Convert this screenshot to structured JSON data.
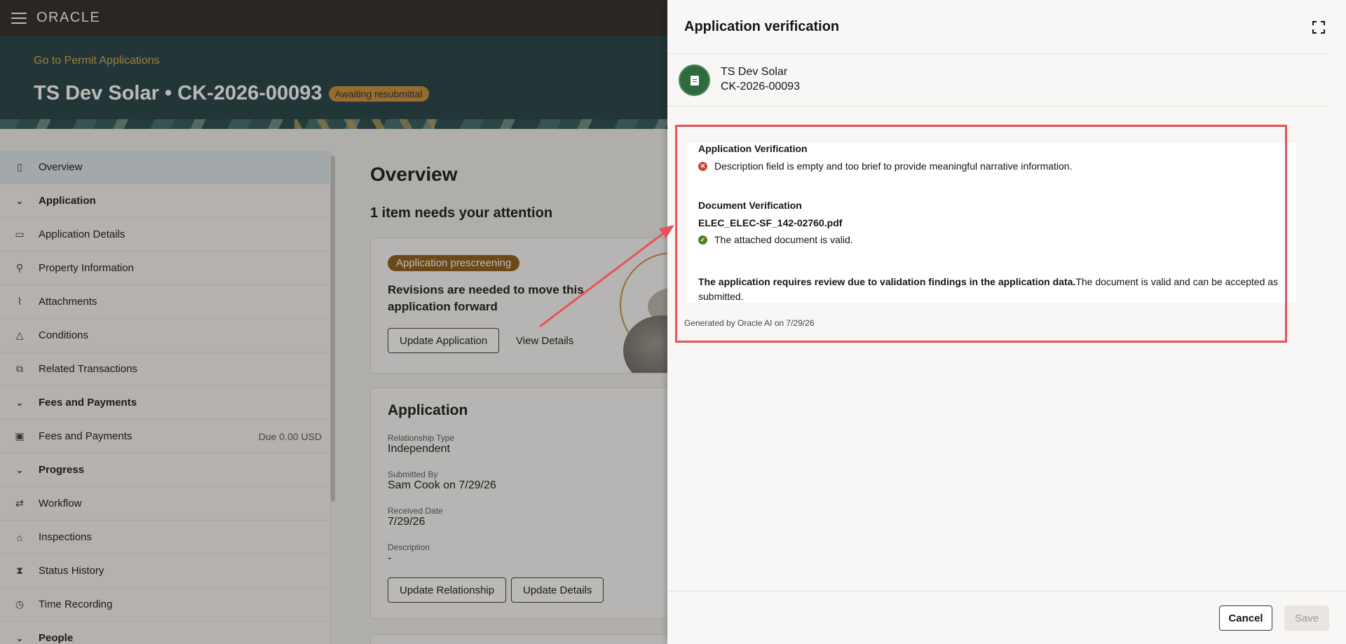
{
  "topbar": {
    "logo": "ORACLE"
  },
  "header": {
    "back_link": "Go to Permit Applications",
    "title": "TS Dev Solar • CK-2026-00093",
    "status": "Awaiting resubmittal"
  },
  "sidebar": {
    "items": [
      {
        "label": "Overview",
        "icon": "overview-icon",
        "type": "item",
        "active": true
      },
      {
        "label": "Application",
        "icon": "chevron-down-icon",
        "type": "section"
      },
      {
        "label": "Application Details",
        "icon": "clipboard-icon",
        "type": "item"
      },
      {
        "label": "Property Information",
        "icon": "map-pin-icon",
        "type": "item"
      },
      {
        "label": "Attachments",
        "icon": "paperclip-icon",
        "type": "item"
      },
      {
        "label": "Conditions",
        "icon": "warning-icon",
        "type": "item"
      },
      {
        "label": "Related Transactions",
        "icon": "linked-doc-icon",
        "type": "item"
      },
      {
        "label": "Fees and Payments",
        "icon": "chevron-down-icon",
        "type": "section"
      },
      {
        "label": "Fees and Payments",
        "icon": "wallet-icon",
        "type": "item",
        "right": "Due 0.00 USD"
      },
      {
        "label": "Progress",
        "icon": "chevron-down-icon",
        "type": "section"
      },
      {
        "label": "Workflow",
        "icon": "workflow-icon",
        "type": "item"
      },
      {
        "label": "Inspections",
        "icon": "inspection-icon",
        "type": "item"
      },
      {
        "label": "Status History",
        "icon": "hourglass-icon",
        "type": "item"
      },
      {
        "label": "Time Recording",
        "icon": "clock-icon",
        "type": "item"
      },
      {
        "label": "People",
        "icon": "chevron-down-icon",
        "type": "section"
      }
    ]
  },
  "main": {
    "title": "Overview",
    "attention": "1 item needs your attention",
    "prescreen": {
      "badge": "Application prescreening",
      "text": "Revisions are needed to move this application forward",
      "update_button": "Update Application",
      "view_link": "View Details"
    },
    "application": {
      "title": "Application",
      "relationship_label": "Relationship Type",
      "relationship_value": "Independent",
      "submitted_label": "Submitted By",
      "submitted_value": "Sam Cook on 7/29/26",
      "received_label": "Received Date",
      "received_value": "7/29/26",
      "description_label": "Description",
      "description_value": "-",
      "update_relationship": "Update Relationship",
      "update_details": "Update Details"
    }
  },
  "drawer": {
    "title": "Application verification",
    "record_name": "TS Dev Solar",
    "record_id": "CK-2026-00093",
    "app_verification_heading": "Application Verification",
    "app_verification_msg": "Description field is empty and too brief to provide meaningful narrative information.",
    "doc_verification_heading": "Document Verification",
    "doc_filename": "ELEC_ELEC-SF_142-02760.pdf",
    "doc_msg": "The attached document is valid.",
    "summary_bold": "The application requires review due to validation findings in the application data.",
    "summary_rest": "The document is valid and can be accepted as submitted.",
    "generated": "Generated by Oracle AI on 7/29/26",
    "cancel": "Cancel",
    "save": "Save"
  },
  "colors": {
    "topbar": "#2b2724",
    "header": "#1f3f43",
    "accent_link": "#d7a94d",
    "status_pill": "#c99038",
    "badge": "#8b5a16",
    "error": "#c74634",
    "success": "#508223",
    "annotation": "#e8535a"
  }
}
